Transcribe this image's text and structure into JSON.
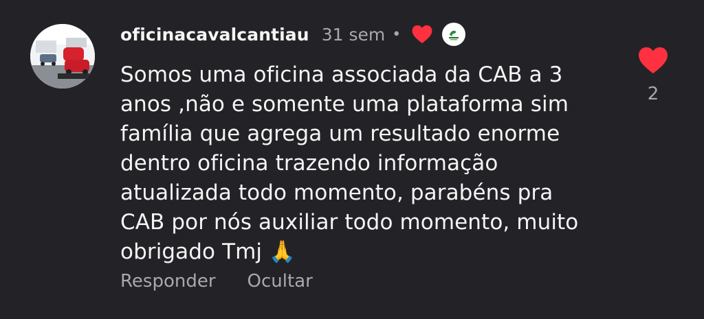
{
  "comment": {
    "username": "oficinacavalcantiau",
    "timestamp": "31 sem",
    "separator": "•",
    "text": "Somos uma oficina associada da CAB a 3 anos ,não e somente uma plataforma sim família que agrega um resultado enorme dentro oficina trazendo informação atualizada todo momento, parabéns pra CAB por nós auxiliar todo momento, muito obrigado Tmj 🙏",
    "like_count": "2",
    "actions": {
      "reply_label": "Responder",
      "hide_label": "Ocultar"
    },
    "icons": {
      "liked_by_author": "heart-icon",
      "author_avatar": "cab-logo",
      "like": "heart-icon",
      "avatar": "workshop-photo"
    },
    "colors": {
      "background": "#232327",
      "heart": "#ff3040",
      "muted_text": "#a8a8ad",
      "primary_text": "#f5f5f5"
    }
  }
}
